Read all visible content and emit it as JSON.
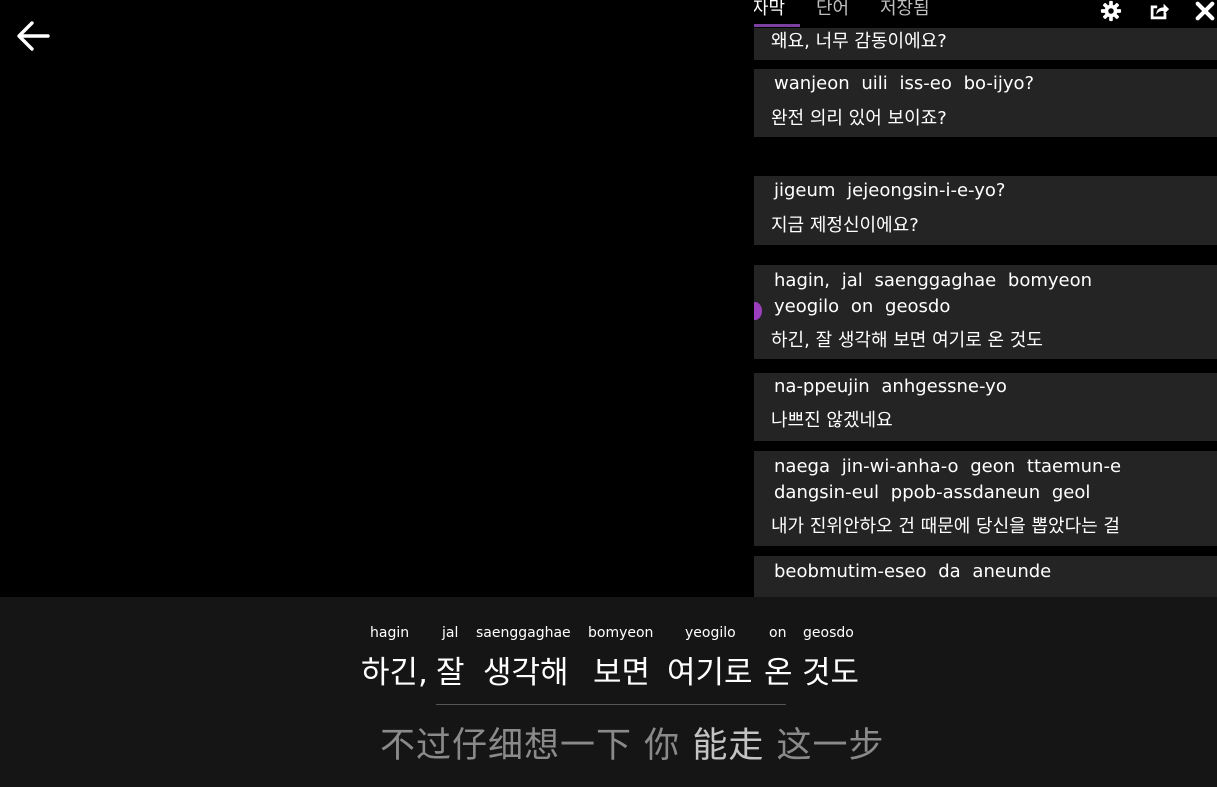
{
  "back": {
    "icon": "arrow-left-icon"
  },
  "panel": {
    "tabs": [
      {
        "label": "자막",
        "active": true
      },
      {
        "label": "단어",
        "active": false
      },
      {
        "label": "저장됨",
        "active": false
      }
    ],
    "tools": [
      "gear-icon",
      "share-icon",
      "close-icon"
    ],
    "accent": "#7b3fa0",
    "cards": [
      {
        "romanized": [],
        "korean": "왜요, 너무 감동이에요?"
      },
      {
        "romanized": [
          "wanjeon uili iss-eo bo-ijyo?"
        ],
        "korean": "완전 의리 있어 보이죠?"
      },
      {
        "romanized": [
          "jigeum jejeongsin-i-e-yo?"
        ],
        "korean": "지금 제정신이에요?"
      },
      {
        "romanized": [
          "hagin, jal saenggaghae bomyeon",
          "yeogilo on geosdo"
        ],
        "korean": "하긴, 잘 생각해 보면 여기로 온 것도",
        "current": true
      },
      {
        "romanized": [
          "na-ppeujin anhgessne-yo"
        ],
        "korean": "나쁘진 않겠네요"
      },
      {
        "romanized": [
          "naega jin-wi-anha-o geon ttaemun-e",
          "dangsin-eul ppob-assdaneun geol"
        ],
        "korean": "내가 진위안하오 건 때문에 당신을 뽑았다는 걸"
      },
      {
        "romanized": [
          "beobmutim-eseo da aneunde"
        ],
        "korean": ""
      }
    ]
  },
  "subtitle": {
    "words": [
      {
        "gloss": "hagin",
        "korean": "하긴,"
      },
      {
        "gloss": "jal",
        "korean": "잘"
      },
      {
        "gloss": "saenggaghae",
        "korean": "생각해"
      },
      {
        "gloss": "bomyeon",
        "korean": "보면"
      },
      {
        "gloss": "yeogilo",
        "korean": "여기로"
      },
      {
        "gloss": "on",
        "korean": "온"
      },
      {
        "gloss": "geosdo",
        "korean": "것도"
      }
    ],
    "translation": {
      "part1": "不过仔细想一下",
      "part2": "你",
      "part3": "能走",
      "part4": "这一步"
    }
  }
}
